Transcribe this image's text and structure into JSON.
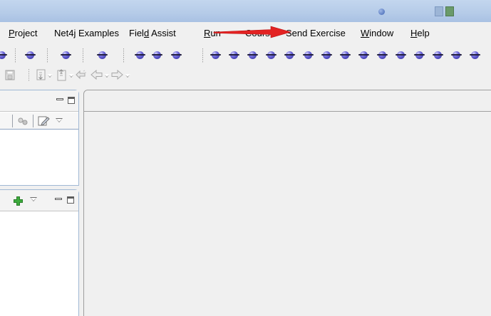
{
  "menubar": {
    "items": [
      {
        "label": "Project",
        "mnemonic": "P"
      },
      {
        "label": "Net4j Examples",
        "mnemonic": ""
      },
      {
        "label": "Field Assist",
        "mnemonic": "d"
      },
      {
        "label": "Run",
        "mnemonic": "R"
      },
      {
        "label": "Course",
        "mnemonic": ""
      },
      {
        "label": "Send Exercise",
        "mnemonic": ""
      },
      {
        "label": "Window",
        "mnemonic": "W"
      },
      {
        "label": "Help",
        "mnemonic": "H"
      }
    ]
  },
  "annotation": {
    "arrow_color": "#e32222",
    "pointing_at": "Send Exercise"
  },
  "colors": {
    "titlebar": "#b5cbe8",
    "menubar_bg": "#f0f0f0",
    "run_button_ball": "#6c67d8",
    "panel_border": "#a0b8d4",
    "add_icon": "#3caa3c"
  },
  "toolbar2": {
    "icons": [
      "save-disabled-icon",
      "next-annotation-icon",
      "previous-annotation-icon",
      "last-edit-location-icon",
      "back-icon",
      "forward-icon"
    ]
  }
}
